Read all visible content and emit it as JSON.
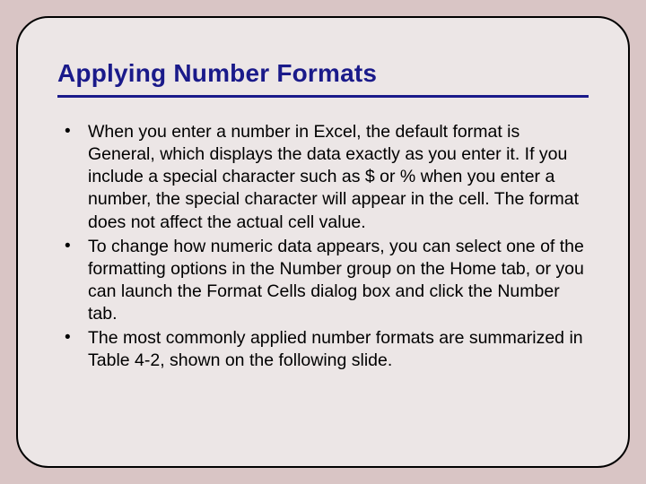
{
  "slide": {
    "title": "Applying Number Formats",
    "bullets": [
      "When you enter a number in Excel, the default format is General, which displays the data exactly as you enter it. If you include a special character such as $ or % when you enter a number, the special character will appear in the cell. The format does not affect the actual cell value.",
      "To change how numeric data appears, you can select one of the formatting options in the Number group on the Home tab, or you can launch the Format Cells dialog box and click the Number tab.",
      "The most commonly applied number formats are summarized in Table 4-2, shown on the following slide."
    ]
  }
}
